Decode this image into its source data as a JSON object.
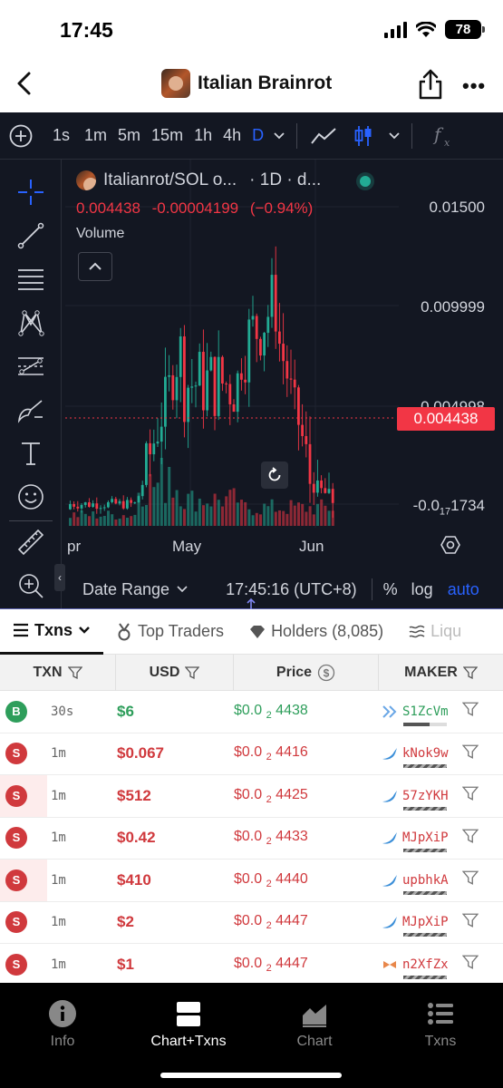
{
  "status_bar": {
    "time": "17:45",
    "battery": "78"
  },
  "header": {
    "title": "Italian Brainrot"
  },
  "chart_toolbar": {
    "timeframes": [
      "1s",
      "1m",
      "5m",
      "15m",
      "1h",
      "4h",
      "D"
    ],
    "active_timeframe": "D"
  },
  "chart_legend": {
    "symbol": "Italianrot/SOL o...",
    "interval": "· 1D · d...",
    "last_price": "0.004438",
    "change": "-0.00004199",
    "change_pct": "(−0.94%)",
    "volume_label": "Volume"
  },
  "price_axis": {
    "labels": [
      "0.01500",
      "0.009999",
      "0.004998"
    ],
    "current_price": "0.004438",
    "volume_scale": "-0.0",
    "volume_scale_sub": "17",
    "volume_scale_end": "1734"
  },
  "time_axis": {
    "labels": [
      "pr",
      "May",
      "Jun"
    ]
  },
  "chart_footer": {
    "date_range": "Date Range",
    "clock": "17:45:16 (UTC+8)",
    "percent": "%",
    "log": "log",
    "auto": "auto"
  },
  "chart_data": {
    "type": "candlestick",
    "symbol": "Italianrot/SOL",
    "interval": "1D",
    "y_axis_ticks": [
      0.015,
      0.009999
    ],
    "y_range": [
      0.0035,
      0.0175
    ],
    "last_price": 0.004438,
    "x_ticks": [
      "pr",
      "May",
      "Jun"
    ]
  },
  "tabs": [
    {
      "label": "Txns"
    },
    {
      "label": "Top Traders"
    },
    {
      "label": "Holders (8,085)"
    },
    {
      "label": "Liqu"
    }
  ],
  "table": {
    "headers": [
      "TXN",
      "USD",
      "Price",
      "MAKER"
    ],
    "rows": [
      {
        "type": "B",
        "age": "30s",
        "usd": "$6",
        "price_pre": "$0.0",
        "price_sub": "2",
        "price_post": "4438",
        "maker": "S1ZcVm"
      },
      {
        "type": "S",
        "age": "1m",
        "usd": "$0.067",
        "price_pre": "$0.0",
        "price_sub": "2",
        "price_post": "4416",
        "maker": "kNok9w"
      },
      {
        "type": "S",
        "age": "1m",
        "usd": "$512",
        "price_pre": "$0.0",
        "price_sub": "2",
        "price_post": "4425",
        "maker": "57zYKH"
      },
      {
        "type": "S",
        "age": "1m",
        "usd": "$0.42",
        "price_pre": "$0.0",
        "price_sub": "2",
        "price_post": "4433",
        "maker": "MJpXiP"
      },
      {
        "type": "S",
        "age": "1m",
        "usd": "$410",
        "price_pre": "$0.0",
        "price_sub": "2",
        "price_post": "4440",
        "maker": "upbhkA"
      },
      {
        "type": "S",
        "age": "1m",
        "usd": "$2",
        "price_pre": "$0.0",
        "price_sub": "2",
        "price_post": "4447",
        "maker": "MJpXiP"
      },
      {
        "type": "S",
        "age": "1m",
        "usd": "$1",
        "price_pre": "$0.0",
        "price_sub": "2",
        "price_post": "4447",
        "maker": "n2XfZx"
      }
    ]
  },
  "bottom_nav": [
    {
      "label": "Info"
    },
    {
      "label": "Chart+Txns"
    },
    {
      "label": "Chart"
    },
    {
      "label": "Txns"
    }
  ],
  "colors": {
    "buy": "#2e9e5b",
    "sell": "#d0393d",
    "chart_bg": "#131722",
    "up_candle": "#22ab94",
    "down_candle": "#f23645",
    "accent": "#2962ff"
  }
}
